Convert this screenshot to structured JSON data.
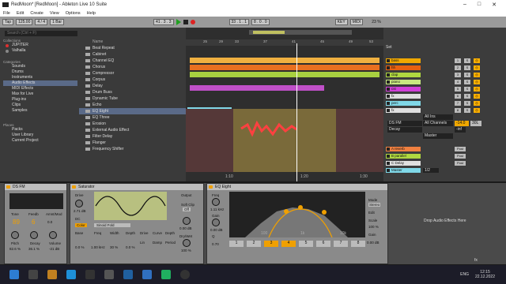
{
  "window": {
    "title": "RedMoon* [RedMoon] - Ableton Live 10 Suite"
  },
  "menu": [
    "File",
    "Edit",
    "Create",
    "View",
    "Options",
    "Help"
  ],
  "transport": {
    "tap": "Tap",
    "tempo": "125.00",
    "bars": "1 Bar",
    "sig": "4 / 4",
    "pos1": "41 . 3 . 3",
    "pos2": "33 . 1 . 1",
    "loop": "8 . 0 . 0",
    "key": "KEY",
    "midi": "MIDI",
    "cpu": "23 %"
  },
  "browser": {
    "search": "Search (Ctrl + F)",
    "collections_title": "Collections",
    "collections": [
      "JUPITER",
      "Valhalla"
    ],
    "categories_title": "Categories",
    "categories": [
      "Sounds",
      "Drums",
      "Instruments",
      "Audio Effects",
      "MIDI Effects",
      "Max for Live",
      "Plug-ins",
      "Clips",
      "Samples"
    ],
    "places_title": "Places",
    "places": [
      "Packs",
      "User Library",
      "Current Project"
    ],
    "name_header": "Name",
    "items": [
      "Beat Repeat",
      "Cabinet",
      "Channel EQ",
      "Chorus",
      "Compressor",
      "Corpus",
      "Delay",
      "Drum Buss",
      "Dynamic Tube",
      "Echo",
      "EQ Eight",
      "EQ Three",
      "Erosion",
      "External Audio Effect",
      "Filter Delay",
      "Flanger",
      "Frequency Shifter"
    ]
  },
  "arrangement": {
    "ruler": [
      "25",
      "29",
      "33",
      "37",
      "41",
      "45",
      "49",
      "53"
    ],
    "time": [
      "1:10",
      "1:20",
      "1:30"
    ],
    "loopstart": "1:10"
  },
  "mixer": {
    "set": "Set",
    "tracks": [
      {
        "name": "bass",
        "color": "#f0a800",
        "n": "1"
      },
      {
        "name": "hh",
        "color": "#e86010",
        "n": "2"
      },
      {
        "name": "clap",
        "color": "#b0d840",
        "n": "3"
      },
      {
        "name": "piano",
        "color": "#c8e880",
        "n": "4"
      },
      {
        "name": "cst",
        "color": "#d040d8",
        "n": "5"
      },
      {
        "name": "fx",
        "color": "#e0e0e0",
        "n": "6"
      },
      {
        "name": "perc",
        "color": "#80d8e8",
        "n": "7"
      },
      {
        "name": "fx",
        "color": "#e0e0e0",
        "n": "8"
      }
    ],
    "io": {
      "input": "All Ins",
      "ch": "DS FM",
      "chan": "All Channels",
      "mon": "Decay",
      "master": "Master",
      "vol": "-14.0",
      "pan": "30L",
      "inf": "-inf"
    },
    "returns": [
      {
        "name": "A reverb",
        "color": "#f08040"
      },
      {
        "name": "B parallel",
        "color": "#b0d840"
      },
      {
        "name": "C Delay",
        "color": "#e0e0e0"
      },
      {
        "name": "Master",
        "color": "#80d8e8"
      }
    ],
    "post": "Post",
    "half": "1/2"
  },
  "devices": {
    "dsfm": {
      "name": "DS FM",
      "tone": "Tone",
      "feedb": "Feedb",
      "amnt": "Amnt/Mod",
      "tone_v": "89",
      "feedb_v": "6",
      "amnt_v": "0.0",
      "pitch": "Pitch",
      "decay": "Decay",
      "volume": "Volume",
      "pitch_v": "82.6 %",
      "decay_v": "36.1 %",
      "volume_v": "-21 dB"
    },
    "sat": {
      "name": "Saturator",
      "drive": "Drive",
      "drive_v": "2.71 dB",
      "dc": "DC",
      "color": "Color",
      "type": "Sinoid Fold",
      "base": "Base",
      "freq": "Freq",
      "width": "Width",
      "depth": "Depth",
      "base_v": "0.0 %",
      "freq_v": "1.00 kHz",
      "width_v": "30 %",
      "depth_v": "0.0 %",
      "drive2": "Drive",
      "curve": "Curve",
      "depth2": "Depth",
      "lin": "Lin",
      "damp": "Damp",
      "period": "Period",
      "output": "Output",
      "softclip": "Soft Clip",
      "off": "Off",
      "out_v": "0.00 dB",
      "drywet": "Dry/Wet",
      "dw_v": "100 %"
    },
    "eq": {
      "name": "EQ Eight",
      "freq": "Freq",
      "freq_v": "1.11 kHz",
      "gain": "Gain",
      "gain_v": "0.00 dB",
      "q": "Q",
      "q_v": "0.70",
      "mode": "Mode",
      "mode_v": "Stereo",
      "edit": "Edit",
      "scale": "Scale",
      "scale_v": "100 %",
      "out_gain": "Gain",
      "out_v": "0.00 dB",
      "bands": [
        "1",
        "2",
        "3",
        "4",
        "5",
        "6",
        "7",
        "8"
      ],
      "axis": [
        "100",
        "1k",
        "10k"
      ]
    },
    "drop": "Drop Audio Effects Here"
  },
  "status": {
    "fx": "fx"
  },
  "taskbar": {
    "time": "12:15",
    "date": "22.12.2022",
    "lang": "ENG"
  }
}
